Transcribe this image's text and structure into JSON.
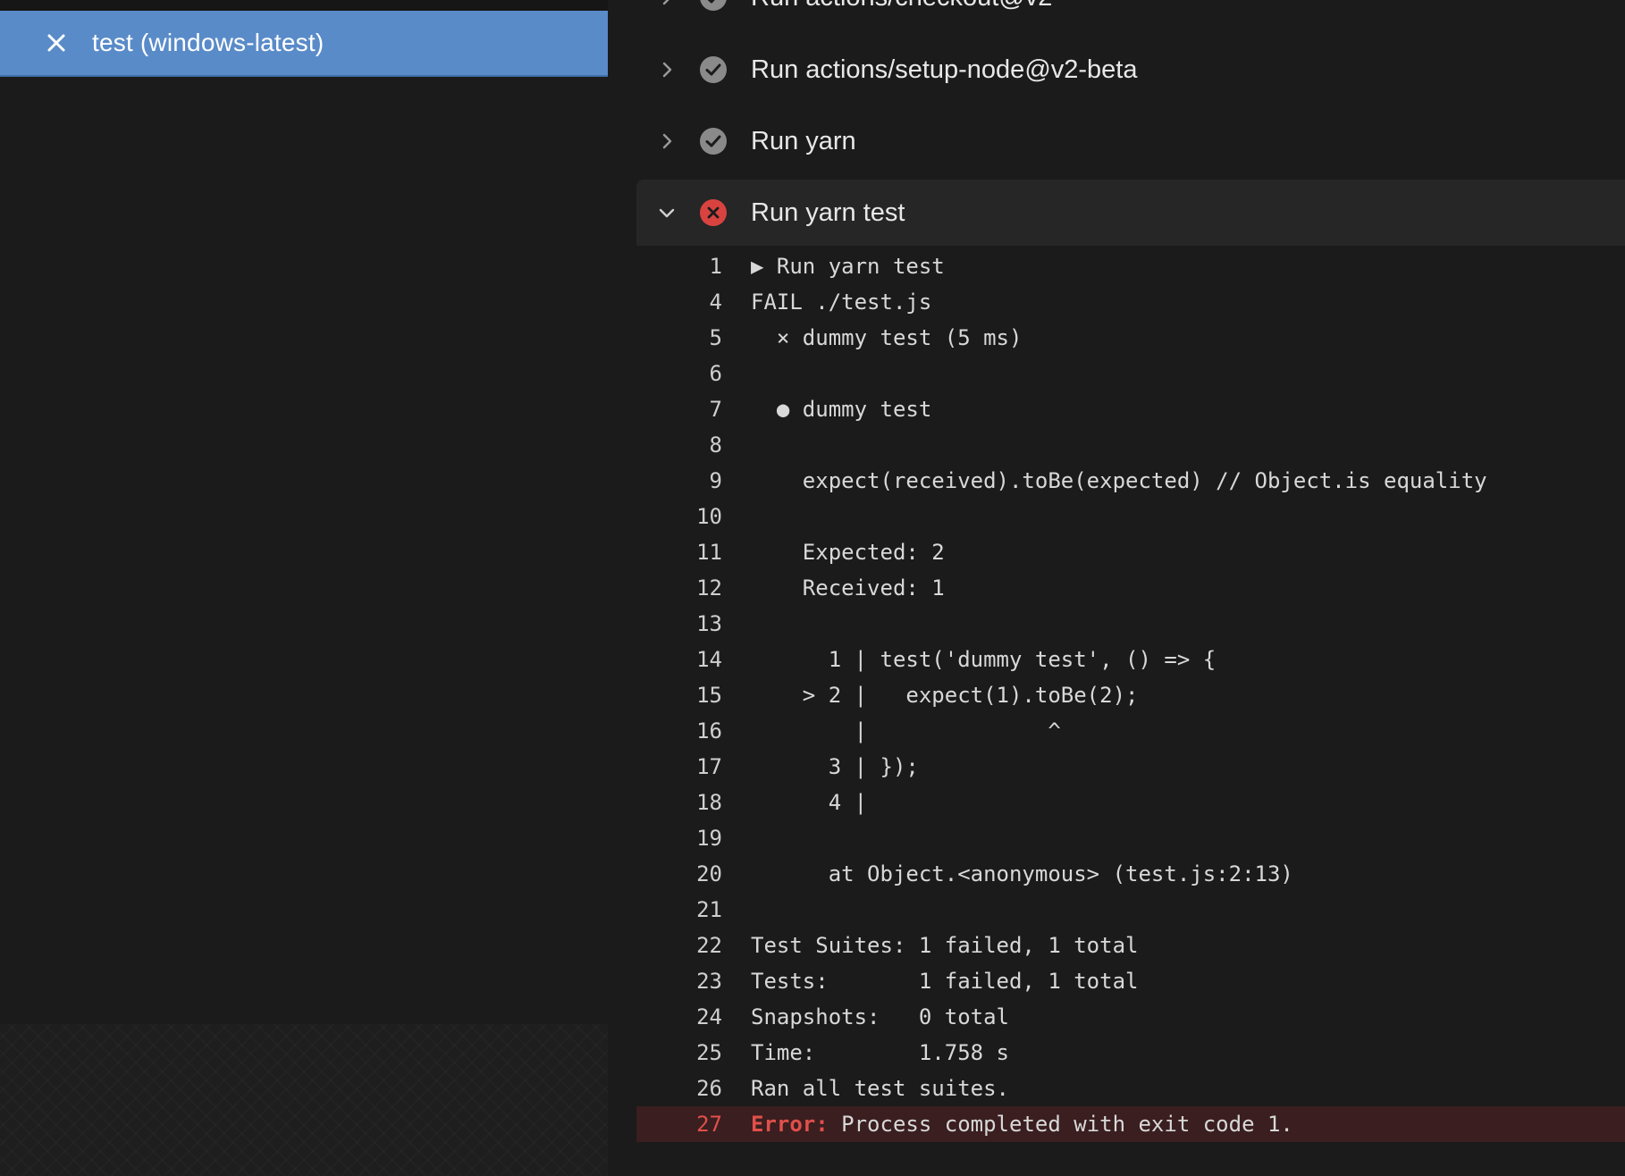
{
  "sidebar": {
    "job": {
      "label": "test (windows-latest)",
      "status_icon": "close-icon"
    }
  },
  "steps": [
    {
      "label": "Run actions/checkout@v2",
      "status": "success",
      "expanded": false
    },
    {
      "label": "Run actions/setup-node@v2-beta",
      "status": "success",
      "expanded": false
    },
    {
      "label": "Run yarn",
      "status": "success",
      "expanded": false
    },
    {
      "label": "Run yarn test",
      "status": "failure",
      "expanded": true
    }
  ],
  "log": [
    {
      "n": "1",
      "text": "▶ Run yarn test"
    },
    {
      "n": "4",
      "text": "FAIL ./test.js"
    },
    {
      "n": "5",
      "text": "  × dummy test (5 ms)"
    },
    {
      "n": "6",
      "text": ""
    },
    {
      "n": "7",
      "text": "  ● dummy test"
    },
    {
      "n": "8",
      "text": ""
    },
    {
      "n": "9",
      "text": "    expect(received).toBe(expected) // Object.is equality"
    },
    {
      "n": "10",
      "text": ""
    },
    {
      "n": "11",
      "text": "    Expected: 2"
    },
    {
      "n": "12",
      "text": "    Received: 1"
    },
    {
      "n": "13",
      "text": ""
    },
    {
      "n": "14",
      "text": "      1 | test('dummy test', () => {"
    },
    {
      "n": "15",
      "text": "    > 2 |   expect(1).toBe(2);"
    },
    {
      "n": "16",
      "text": "        |              ^"
    },
    {
      "n": "17",
      "text": "      3 | });"
    },
    {
      "n": "18",
      "text": "      4 |"
    },
    {
      "n": "19",
      "text": ""
    },
    {
      "n": "20",
      "text": "      at Object.<anonymous> (test.js:2:13)"
    },
    {
      "n": "21",
      "text": ""
    },
    {
      "n": "22",
      "text": "Test Suites: 1 failed, 1 total"
    },
    {
      "n": "23",
      "text": "Tests:       1 failed, 1 total"
    },
    {
      "n": "24",
      "text": "Snapshots:   0 total"
    },
    {
      "n": "25",
      "text": "Time:        1.758 s"
    },
    {
      "n": "26",
      "text": "Ran all test suites."
    },
    {
      "n": "27",
      "error_prefix": "Error:",
      "text": " Process completed with exit code 1."
    }
  ],
  "colors": {
    "selected_job_bg": "#5a8bc9",
    "success_icon": "#8a8a8a",
    "failure_icon": "#d9433f",
    "error_text": "#e0504a",
    "error_row_bg": "#3a1e20"
  }
}
